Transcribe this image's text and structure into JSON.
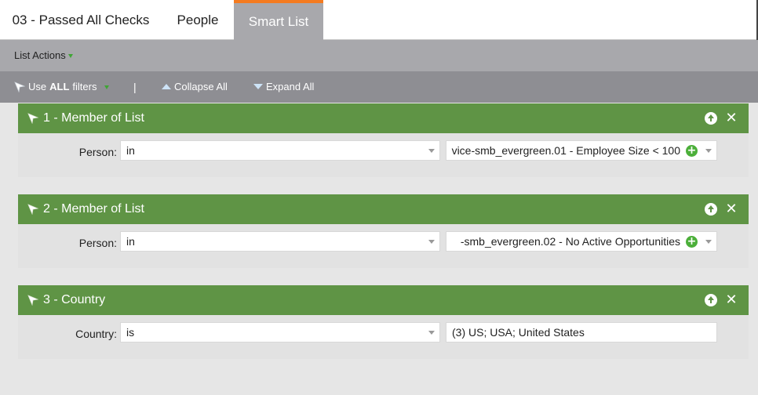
{
  "tabs": [
    {
      "label": "03 - Passed All Checks",
      "active": false
    },
    {
      "label": "People",
      "active": false
    },
    {
      "label": "Smart List",
      "active": true
    }
  ],
  "actions_bar": {
    "list_actions_label": "List Actions"
  },
  "filter_toolbar": {
    "use_label": "Use",
    "use_bold": "ALL",
    "use_suffix": "filters",
    "separator": "|",
    "collapse_label": "Collapse All",
    "expand_label": "Expand All"
  },
  "filters": [
    {
      "title": "1 - Member of List",
      "field_label": "Person:",
      "operator": "in",
      "value": "vice-smb_evergreen.01 - Employee Size < 100"
    },
    {
      "title": "2 - Member of List",
      "field_label": "Person:",
      "operator": "in",
      "value": "-smb_evergreen.02 - No Active Opportunities"
    },
    {
      "title": "3 - Country",
      "field_label": "Country:",
      "operator": "is",
      "value": "(3) US; USA; United States"
    }
  ],
  "colors": {
    "accent_tab": "#f47b20",
    "filter_header": "#5f9445",
    "add_icon": "#4caf3a"
  },
  "icons": {
    "move_up": "arrow-up-circle-icon",
    "remove": "close-icon",
    "add": "plus-circle-icon",
    "filter": "funnel-icon"
  }
}
